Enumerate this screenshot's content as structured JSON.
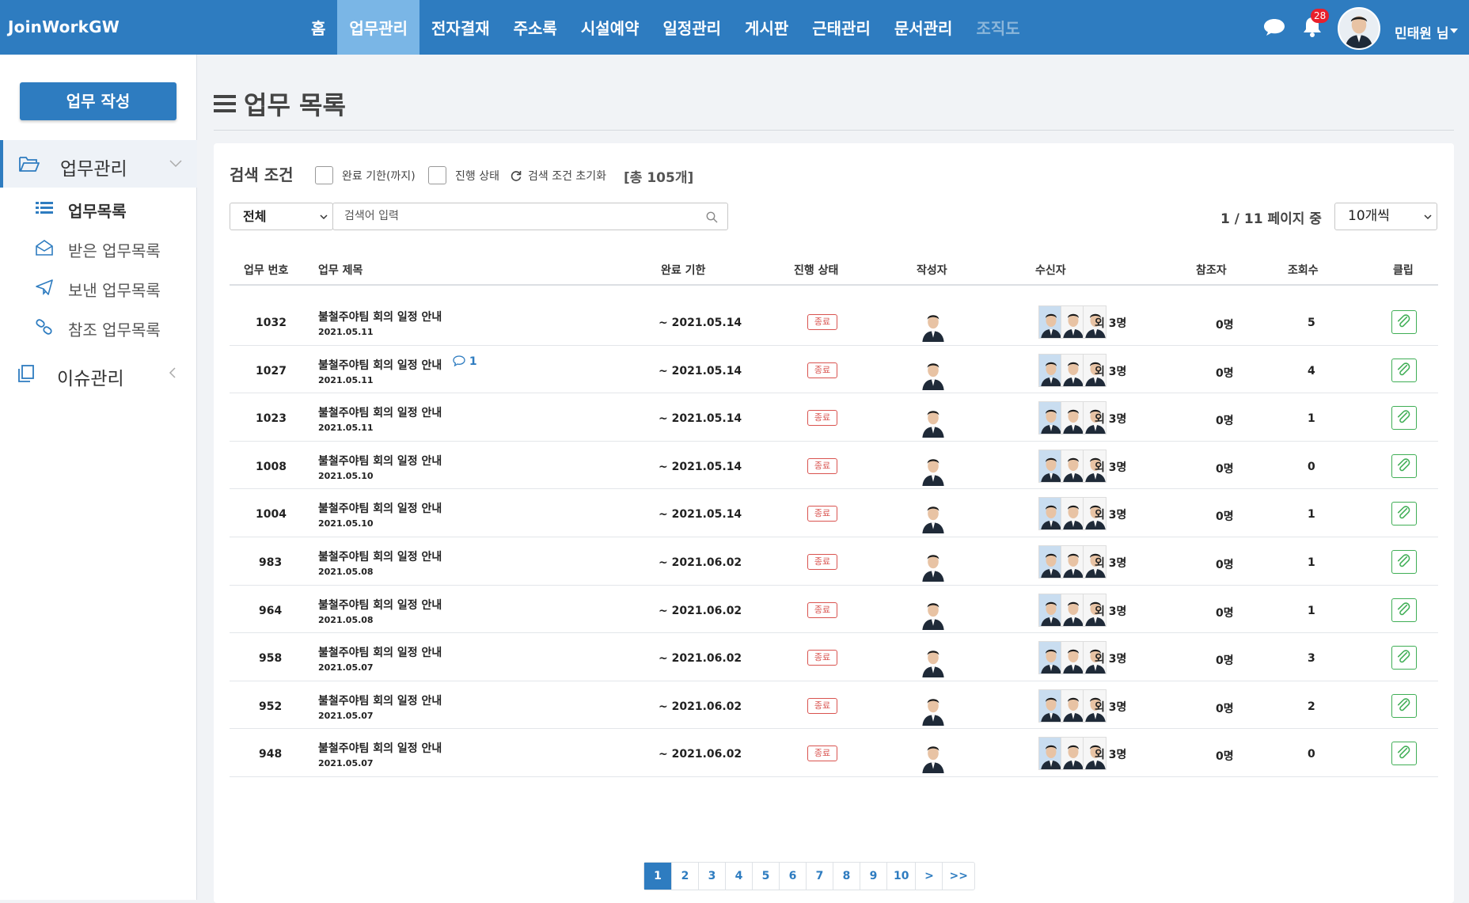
{
  "app": {
    "brand": "JoinWorkGW"
  },
  "nav": {
    "items": [
      "홈",
      "업무관리",
      "전자결재",
      "주소록",
      "시설예약",
      "일정관리",
      "게시판",
      "근태관리",
      "문서관리",
      "조직도"
    ],
    "active_index": 1,
    "disabled_index": 9
  },
  "header": {
    "notif_count": "28",
    "user_name": "민태원 님"
  },
  "sidebar": {
    "write_button": "업무 작성",
    "group1": "업무관리",
    "group1_items": [
      "업무목록",
      "받은 업무목록",
      "보낸 업무목록",
      "참조 업무목록"
    ],
    "group2": "이슈관리"
  },
  "page": {
    "title": "업무 목록"
  },
  "filters": {
    "title": "검색 조건",
    "check_deadline": "완료 기한(까지)",
    "check_status": "진행 상태",
    "reset": "검색 조건 초기화",
    "total": "[총 105개]",
    "select_value": "전체",
    "search_placeholder": "검색어 입력",
    "page_info": "1 / 11 페이지 중",
    "per_page": "10개씩"
  },
  "table": {
    "headers": [
      "업무 번호",
      "업무 제목",
      "완료 기한",
      "진행 상태",
      "작성자",
      "수신자",
      "참조자",
      "조회수",
      "클립"
    ],
    "rows": [
      {
        "num": "1032",
        "title": "불철주야팀 회의 일정 안내",
        "date": "2021.05.11",
        "due": "~ 2021.05.14",
        "status": "종료",
        "recv_more": "외 3명",
        "ref": "0명",
        "views": "5",
        "comments": ""
      },
      {
        "num": "1027",
        "title": "불철주야팀 회의 일정 안내",
        "date": "2021.05.11",
        "due": "~ 2021.05.14",
        "status": "종료",
        "recv_more": "외 3명",
        "ref": "0명",
        "views": "4",
        "comments": "1"
      },
      {
        "num": "1023",
        "title": "불철주야팀 회의 일정 안내",
        "date": "2021.05.11",
        "due": "~ 2021.05.14",
        "status": "종료",
        "recv_more": "외 3명",
        "ref": "0명",
        "views": "1",
        "comments": ""
      },
      {
        "num": "1008",
        "title": "불철주야팀 회의 일정 안내",
        "date": "2021.05.10",
        "due": "~ 2021.05.14",
        "status": "종료",
        "recv_more": "외 3명",
        "ref": "0명",
        "views": "0",
        "comments": ""
      },
      {
        "num": "1004",
        "title": "불철주야팀 회의 일정 안내",
        "date": "2021.05.10",
        "due": "~ 2021.05.14",
        "status": "종료",
        "recv_more": "외 3명",
        "ref": "0명",
        "views": "1",
        "comments": ""
      },
      {
        "num": "983",
        "title": "불철주야팀 회의 일정 안내",
        "date": "2021.05.08",
        "due": "~ 2021.06.02",
        "status": "종료",
        "recv_more": "외 3명",
        "ref": "0명",
        "views": "1",
        "comments": ""
      },
      {
        "num": "964",
        "title": "불철주야팀 회의 일정 안내",
        "date": "2021.05.08",
        "due": "~ 2021.06.02",
        "status": "종료",
        "recv_more": "외 3명",
        "ref": "0명",
        "views": "1",
        "comments": ""
      },
      {
        "num": "958",
        "title": "불철주야팀 회의 일정 안내",
        "date": "2021.05.07",
        "due": "~ 2021.06.02",
        "status": "종료",
        "recv_more": "외 3명",
        "ref": "0명",
        "views": "3",
        "comments": ""
      },
      {
        "num": "952",
        "title": "불철주야팀 회의 일정 안내",
        "date": "2021.05.07",
        "due": "~ 2021.06.02",
        "status": "종료",
        "recv_more": "외 3명",
        "ref": "0명",
        "views": "2",
        "comments": ""
      },
      {
        "num": "948",
        "title": "불철주야팀 회의 일정 안내",
        "date": "2021.05.07",
        "due": "~ 2021.06.02",
        "status": "종료",
        "recv_more": "외 3명",
        "ref": "0명",
        "views": "0",
        "comments": ""
      }
    ]
  },
  "pagination": {
    "pages": [
      "1",
      "2",
      "3",
      "4",
      "5",
      "6",
      "7",
      "8",
      "9",
      "10",
      ">",
      ">>"
    ],
    "active": "1"
  },
  "colors": {
    "primary": "#2e7cc0",
    "nav_active": "#7ab6e6",
    "status": "#d9534f",
    "clip": "#3fae55"
  }
}
